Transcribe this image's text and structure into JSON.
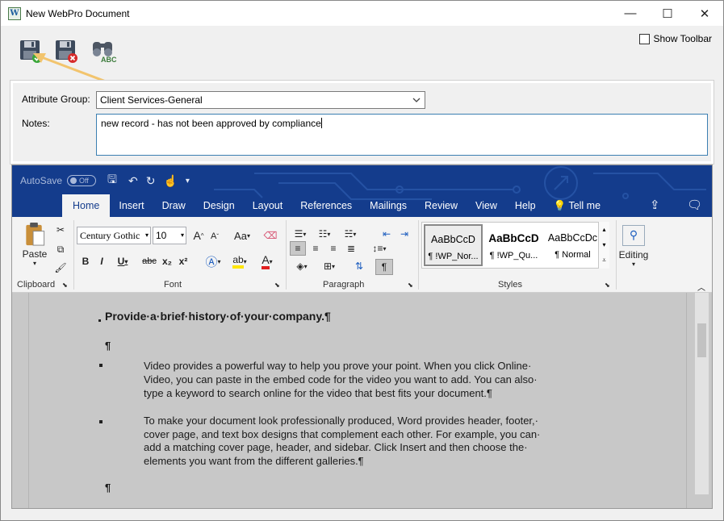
{
  "window": {
    "title": "New WebPro Document",
    "app_icon_letter": "W",
    "controls": {
      "minimize": "—",
      "maximize": "☐",
      "close": "✕"
    }
  },
  "toolbar": {
    "show_toolbar_label": "Show Toolbar",
    "show_toolbar_checked": false,
    "buttons": [
      "save-approve-icon",
      "save-reject-icon",
      "find-spell-icon"
    ],
    "spell_label": "ABC"
  },
  "attributes": {
    "group_label": "Attribute Group:",
    "group_value": "Client Services-General",
    "notes_label": "Notes:",
    "notes_value": "new record - has not been approved by compliance"
  },
  "word": {
    "qat": {
      "autosave": "AutoSave",
      "toggle": "Off"
    },
    "tabs": [
      "Home",
      "Insert",
      "Draw",
      "Design",
      "Layout",
      "References",
      "Mailings",
      "Review",
      "View",
      "Help"
    ],
    "active_tab": "Home",
    "tell_me": "Tell me",
    "ribbon": {
      "clipboard": {
        "paste": "Paste",
        "label": "Clipboard"
      },
      "font": {
        "name": "Century Gothic",
        "size": "10",
        "label": "Font",
        "bold": "B",
        "italic": "I",
        "underline": "U",
        "strike": "abc",
        "sub": "x₂",
        "sup": "x²",
        "grow": "A",
        "shrink": "A",
        "case": "Aa"
      },
      "paragraph": {
        "label": "Paragraph"
      },
      "styles": {
        "label": "Styles",
        "items": [
          {
            "sample": "AaBbCcD",
            "name": "¶ !WP_Nor..."
          },
          {
            "sample": "AaBbCcD",
            "name": "¶ !WP_Qu..."
          },
          {
            "sample": "AaBbCcDc",
            "name": "¶ Normal"
          }
        ]
      },
      "editing": {
        "label": "Editing"
      }
    },
    "document": {
      "heading": "Provide·a·brief·history·of·your·company.¶",
      "pilcrow1": "¶",
      "bullets": [
        [
          "Video provides a powerful way to help you prove your point. When you click Online·",
          "Video, you can paste in the embed code for the video you want to add. You can also·",
          "type a keyword to search online for the video that best fits your document.¶"
        ],
        [
          "To make your document look professionally produced, Word provides header, footer,·",
          "cover page, and text box designs that complement each other. For example, you can·",
          "add a matching cover page, header, and sidebar. Click Insert and then choose the·",
          "elements you want from the different galleries.¶"
        ]
      ],
      "pilcrow2": "¶"
    }
  },
  "colors": {
    "ribbon_blue": "#143c8c",
    "arrow": "#f2c46d",
    "notes_border": "#3c7fb1"
  }
}
